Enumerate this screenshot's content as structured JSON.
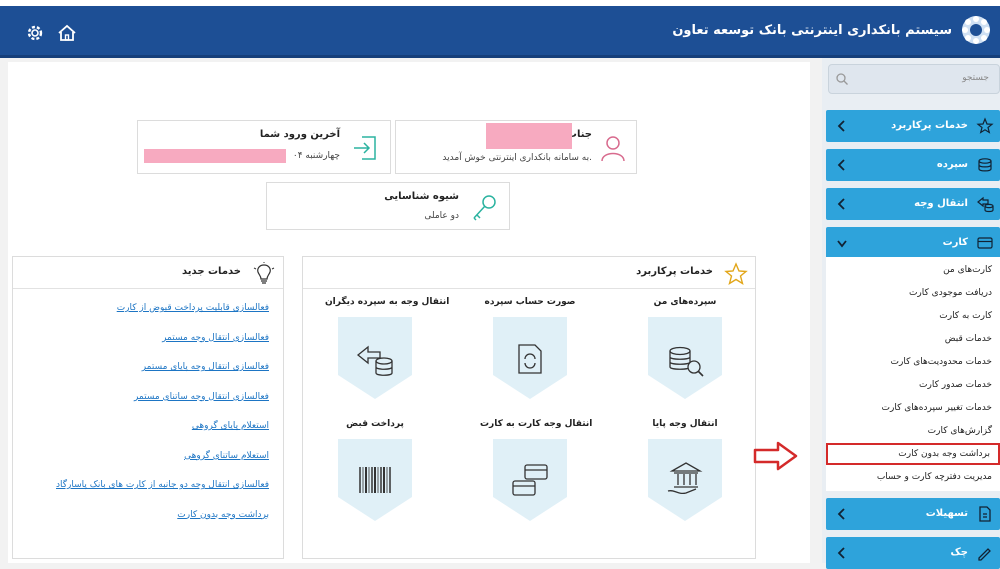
{
  "header": {
    "title": "سیستم بانکداری اینترنتی بانک توسعه تعاون",
    "home_icon": "home-icon",
    "settings_icon": "gear-icon"
  },
  "welcome_card": {
    "prefix": "جناب",
    "message": "به سامانه بانکداری اینترنتی خوش آمدید.",
    "icon": "user-icon"
  },
  "last_login_card": {
    "title": "آخرین ورود شما",
    "value_prefix": "چهارشنبه ۰۴",
    "icon": "login-icon"
  },
  "auth_card": {
    "title": "شیوه شناسایی",
    "value": "دو عاملی",
    "icon": "key-icon"
  },
  "popular_services": {
    "title": "خدمات پرکاربرد",
    "icon": "star-icon",
    "items": [
      {
        "label": "سپرده‌های من",
        "icon": "coins-search-icon"
      },
      {
        "label": "صورت حساب سپرده",
        "icon": "statement-icon"
      },
      {
        "label": "انتقال وجه به سپرده دیگران",
        "icon": "coins-transfer-icon"
      },
      {
        "label": "انتقال وجه پایا",
        "icon": "bank-icon"
      },
      {
        "label": "انتقال وجه کارت به کارت",
        "icon": "card-to-card-icon"
      },
      {
        "label": "پرداخت قبض",
        "icon": "barcode-icon"
      }
    ]
  },
  "new_services": {
    "title": "خدمات جدید",
    "icon": "lightbulb-icon",
    "links": [
      "فعالسازی قابلیت پرداخت قبوض از کارت",
      "فعالسازی انتقال وجه مستمر",
      "فعالسازی انتقال وجه پایای مستمر",
      "فعالسازی انتقال وجه ساتنای مستمر",
      "استعلام پایای گروهی",
      "استعلام ساتنای گروهی",
      "فعالسازی انتقال وجه دو جانبه از کارت های بانک پاسارگاد",
      "برداشت وجه بدون کارت"
    ]
  },
  "sidebar": {
    "search_placeholder": "جستجو",
    "menus": [
      {
        "label": "خدمات پرکاربرد",
        "icon": "star-icon"
      },
      {
        "label": "سپرده",
        "icon": "coins-icon"
      },
      {
        "label": "انتقال وجه",
        "icon": "transfer-icon"
      },
      {
        "label": "کارت",
        "icon": "card-icon"
      },
      {
        "label": "تسهیلات",
        "icon": "document-icon"
      },
      {
        "label": "چک",
        "icon": "check-icon"
      }
    ],
    "card_submenu": [
      "کارت‌های من",
      "دریافت موجودی کارت",
      "کارت به کارت",
      "خدمات قبض",
      "خدمات محدودیت‌های کارت",
      "خدمات صدور کارت",
      "خدمات تغییر سپرده‌های کارت",
      "گزارش‌های کارت",
      "برداشت وجه بدون کارت",
      "مدیریت دفترچه کارت و حساب"
    ],
    "highlighted_item": "برداشت وجه بدون کارت"
  },
  "colors": {
    "header": "#1d4f95",
    "menu": "#2ea3db",
    "highlight": "#d42a2a",
    "link": "#1d75c4",
    "redaction": "#f7aac0"
  }
}
